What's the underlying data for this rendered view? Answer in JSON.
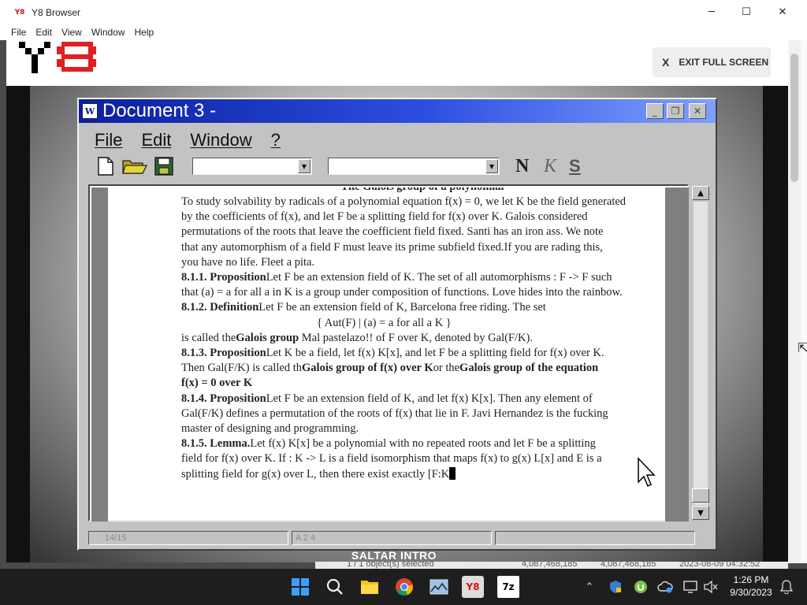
{
  "browser": {
    "logo_text": "Y8",
    "title": "Y8 Browser",
    "minimize": "─",
    "maximize": "☐",
    "close": "✕",
    "menu": [
      "File",
      "Edit",
      "View",
      "Window",
      "Help"
    ]
  },
  "site": {
    "exit_full_screen_x": "X",
    "exit_full_screen": "EXIT FULL SCREEN"
  },
  "doc": {
    "icon": "W",
    "title": "Document 3 -",
    "menu": [
      "File",
      "Edit",
      "Window",
      "?"
    ],
    "format_buttons": {
      "bold": "N",
      "italic": "K",
      "underline": "S"
    },
    "cut_heading": "The Galois group of a polynomial",
    "lines": [
      "To study solvability by radicals of a polynomial equation f(x) = 0, we let K be the field generated",
      "by the coefficients of f(x), and let F be a splitting field for f(x) over K. Galois considered",
      "permutations of the roots that leave the coefficient field fixed. Santi  has an iron ass. We note",
      "that any automorphism of a field F must leave its prime subfield fixed.If you are rading this,",
      "you have no life. Fleet a pita."
    ],
    "p811_head": "8.1.1. Proposition",
    "p811_line1": "Let F be an extension field of K. The set of all automorphisms : F -> F such",
    "p811_line2": "that (a) = a for all a in K is a group under composition of functions. Love hides into the rainbow.",
    "p812_head": "8.1.2. Definition",
    "p812_line1": "Let F be an extension field of K, Barcelona free riding. The set",
    "p812_formula": "{ Aut(F) | (a) = a for all a K }",
    "p812_pre": "is called the",
    "p812_bold": "Galois group",
    "p812_post": " Mal pastelazo!! of F over K, denoted by Gal(F/K).",
    "p813_head": "8.1.3. Proposition",
    "p813_line1": "Let K be a field, let f(x) K[x], and let F be a splitting field for f(x) over K.",
    "p813_pre": "Then Gal(F/K) is called th",
    "p813_bold1": "Galois group of f(x) over K",
    "p813_mid": "or the",
    "p813_bold2": "Galois group of the equation",
    "p813_bold3": "f(x) = 0 over K",
    "p814_head": "8.1.4. Proposition",
    "p814_line1": "Let F be an extension field of K, and let f(x) K[x]. Then any element of",
    "p814_line2": "Gal(F/K) defines a permutation of the roots of f(x) that lie in F.  Javi Hernandez is the fucking",
    "p814_line3": "master of designing and programming.",
    "p815_head": "8.1.5. Lemma.",
    "p815_line1": "Let f(x) K[x] be a polynomial with no repeated roots and let F be a splitting",
    "p815_line2": "field for f(x) over K. If : K -> L is a field isomorphism that maps f(x) to g(x) L[x] and E is a",
    "p815_line3": "splitting field for g(x) over L, then there exist exactly [F:K",
    "status_page": "14/15",
    "status_pos": "A 2 4"
  },
  "overlay": {
    "saltar_intro": "SALTAR INTRO",
    "bg_strip": [
      "1 / 1 object(s) selected",
      "4,087,468,185",
      "4,087,468,185",
      "2023-08-09 04:32:52"
    ]
  },
  "taskbar": {
    "archive_icon_label": "7z",
    "y8_icon_label": "Y8",
    "time": "1:26 PM",
    "date": "9/30/2023"
  },
  "colors": {
    "doc_titlebar_start": "#0b1f9e",
    "doc_titlebar_end": "#7fa0ff",
    "win98_gray": "#c3c3c3",
    "taskbar": "#1e1e1e",
    "y8_red": "#e02020"
  }
}
